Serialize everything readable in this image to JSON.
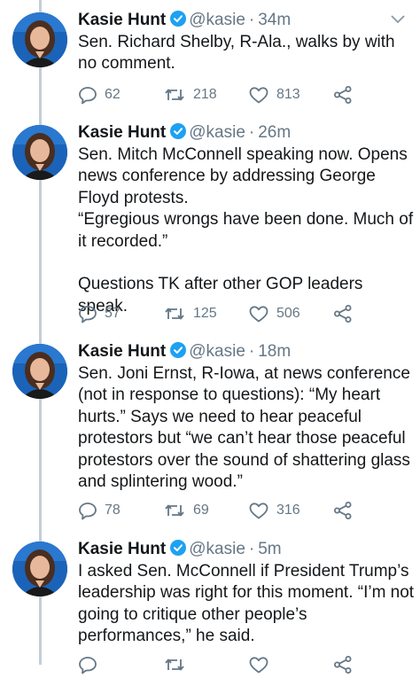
{
  "tweets": [
    {
      "name": "Kasie Hunt",
      "handle": "@kasie",
      "sep": "·",
      "time": "34m",
      "text": "Sen. Richard Shelby, R-Ala., walks by with no comment.",
      "replies": "62",
      "retweets": "218",
      "likes": "813"
    },
    {
      "name": "Kasie Hunt",
      "handle": "@kasie",
      "sep": "·",
      "time": "26m",
      "text": "Sen. Mitch McConnell speaking now. Opens news conference by addressing George Floyd protests.\n“Egregious wrongs have been done. Much of it recorded.”\n\nQuestions TK after other GOP leaders speak.",
      "replies": "57",
      "retweets": "125",
      "likes": "506"
    },
    {
      "name": "Kasie Hunt",
      "handle": "@kasie",
      "sep": "·",
      "time": "18m",
      "text": "Sen. Joni Ernst, R-Iowa, at news conference (not in response to questions): “My heart hurts.” Says we need to hear peaceful protestors but “we can’t hear those peaceful protestors over the sound of shattering glass and splintering wood.”",
      "replies": "78",
      "retweets": "69",
      "likes": "316"
    },
    {
      "name": "Kasie Hunt",
      "handle": "@kasie",
      "sep": "·",
      "time": "5m",
      "text": "I asked Sen. McConnell if President Trump’s leadership was right for this moment. “I’m not going to critique other people’s performances,” he said."
    }
  ],
  "colors": {
    "verified": "#1da1f2",
    "muted": "#657786",
    "thread": "#c4ced6",
    "avatar_bg": "#1b63b8"
  },
  "icons": [
    "reply-icon",
    "retweet-icon",
    "like-icon",
    "share-icon",
    "chevron-down-icon",
    "verified-badge-icon"
  ]
}
